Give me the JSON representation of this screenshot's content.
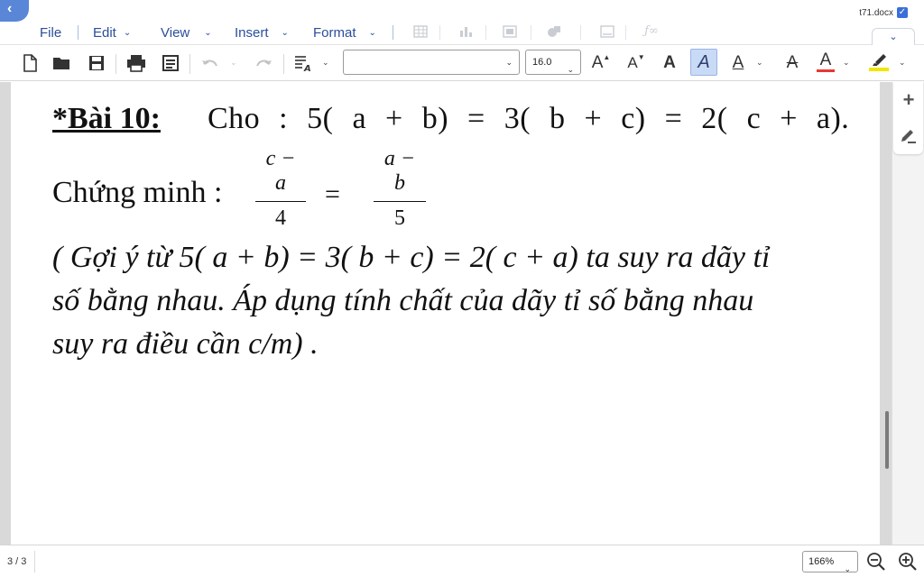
{
  "app": {
    "back_label": "‹",
    "filename": "t71.docx",
    "edit_check": "✓",
    "collapse_label": "⌄"
  },
  "menu": {
    "items": [
      {
        "label": "File",
        "has_dropdown": false
      },
      {
        "label": "Edit",
        "has_dropdown": true
      },
      {
        "label": "View",
        "has_dropdown": true
      },
      {
        "label": "Insert",
        "has_dropdown": true
      },
      {
        "label": "Format",
        "has_dropdown": true
      }
    ],
    "dropdown_glyph": "⌄",
    "disabled_icons": [
      "table-icon",
      "chart-icon",
      "image-icon",
      "shapes-icon",
      "textbox-icon",
      "formula-icon"
    ]
  },
  "toolbar": {
    "font_name": "",
    "font_size": "16.0",
    "grow_font": "A",
    "shrink_font": "A",
    "bold": "A",
    "italic": "A",
    "underline": "A",
    "strikethrough": "A",
    "font_color": "A",
    "dropdown_glyph": "⌄",
    "colors": {
      "font_color_bar": "#e53935",
      "highlight_bar": "#f4e600",
      "active_bg": "#c9daf6"
    }
  },
  "document": {
    "title": "*Bài 10:",
    "cho_equation": "Cho : 5( a + b) = 3( b + c) = 2( c + a).",
    "prove_label": "Chứng minh :",
    "fraction_left": {
      "numerator": "c − a",
      "denominator": "4"
    },
    "fraction_equals": "=",
    "fraction_right": {
      "numerator": "a − b",
      "denominator": "5"
    },
    "hint_lines": [
      " ( Gợi ý  từ 5( a + b) = 3( b + c) = 2( c + a) ta suy ra dãy tỉ",
      "số bằng nhau. Áp dụng tính chất của dãy tỉ số bằng nhau",
      "suy ra điều cần c/m) ."
    ]
  },
  "right_panel": {
    "add_icon": "+",
    "edit_icon": "✎"
  },
  "status": {
    "page_count": "3 / 3",
    "zoom": "166%",
    "zoom_dropdown": "⌄"
  }
}
